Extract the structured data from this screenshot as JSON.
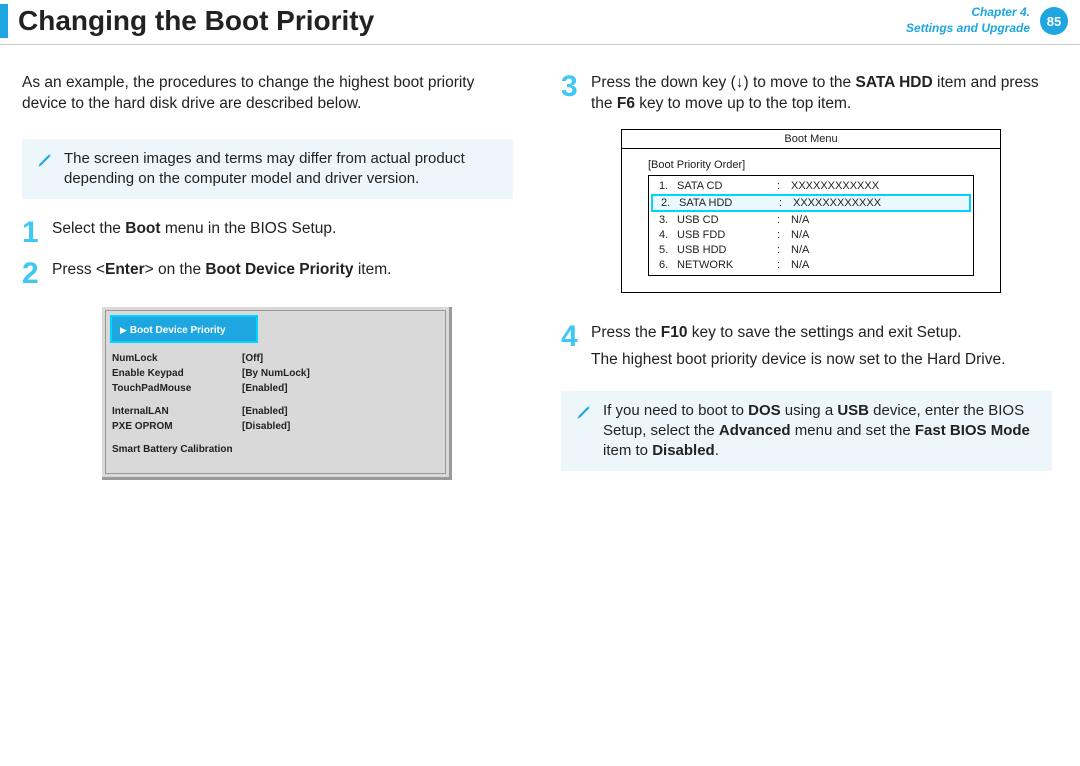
{
  "header": {
    "title": "Changing the Boot Priority",
    "chapter_line1": "Chapter 4.",
    "chapter_line2": "Settings and Upgrade",
    "page": "85"
  },
  "left": {
    "intro": "As an example, the procedures to change the highest boot priority device to the hard disk drive are described below.",
    "note": "The screen images and terms may differ from actual product depending on the computer model and driver version.",
    "step1": {
      "num": "1",
      "pre": "Select the ",
      "b1": "Boot",
      "post": " menu in the BIOS Setup."
    },
    "step2": {
      "num": "2",
      "pre": "Press <",
      "b1": "Enter",
      "mid": "> on the ",
      "b2": "Boot Device Priority",
      "post": " item."
    },
    "bios": {
      "header": "Boot Device Priority",
      "rows": [
        {
          "label": "NumLock",
          "value": "[Off]"
        },
        {
          "label": "Enable Keypad",
          "value": "[By NumLock]"
        },
        {
          "label": "TouchPadMouse",
          "value": "[Enabled]"
        }
      ],
      "rows2": [
        {
          "label": "InternalLAN",
          "value": "[Enabled]"
        },
        {
          "label": "PXE OPROM",
          "value": "[Disabled]"
        }
      ],
      "rows3": [
        {
          "label": "Smart Battery Calibration",
          "value": ""
        }
      ]
    }
  },
  "right": {
    "step3": {
      "num": "3",
      "t1": "Press the down key (↓) to move to the ",
      "b1": "SATA HDD",
      "t2": " item and press the ",
      "b2": "F6",
      "t3": " key to move up to the top item."
    },
    "boot_menu": {
      "title": "Boot Menu",
      "subtitle": "[Boot Priority Order]",
      "items": [
        {
          "idx": "1.",
          "name": "SATA CD",
          "val": "XXXXXXXXXXXX",
          "hl": false
        },
        {
          "idx": "2.",
          "name": "SATA HDD",
          "val": "XXXXXXXXXXXX",
          "hl": true
        },
        {
          "idx": "3.",
          "name": "USB CD",
          "val": "N/A",
          "hl": false
        },
        {
          "idx": "4.",
          "name": "USB FDD",
          "val": "N/A",
          "hl": false
        },
        {
          "idx": "5.",
          "name": "USB HDD",
          "val": "N/A",
          "hl": false
        },
        {
          "idx": "6.",
          "name": "NETWORK",
          "val": "N/A",
          "hl": false
        }
      ]
    },
    "step4": {
      "num": "4",
      "line1_pre": "Press the ",
      "line1_b": "F10",
      "line1_post": " key to save the settings and exit Setup.",
      "line2": "The highest boot priority device is now set to the Hard Drive."
    },
    "note2": {
      "t1": "If you need to boot to ",
      "b1": "DOS",
      "t2": " using a ",
      "b2": "USB",
      "t3": " device, enter the BIOS Setup, select the ",
      "b3": "Advanced",
      "t4": " menu and set the ",
      "b4": "Fast BIOS Mode",
      "t5": " item to ",
      "b5": "Disabled",
      "t6": "."
    }
  }
}
